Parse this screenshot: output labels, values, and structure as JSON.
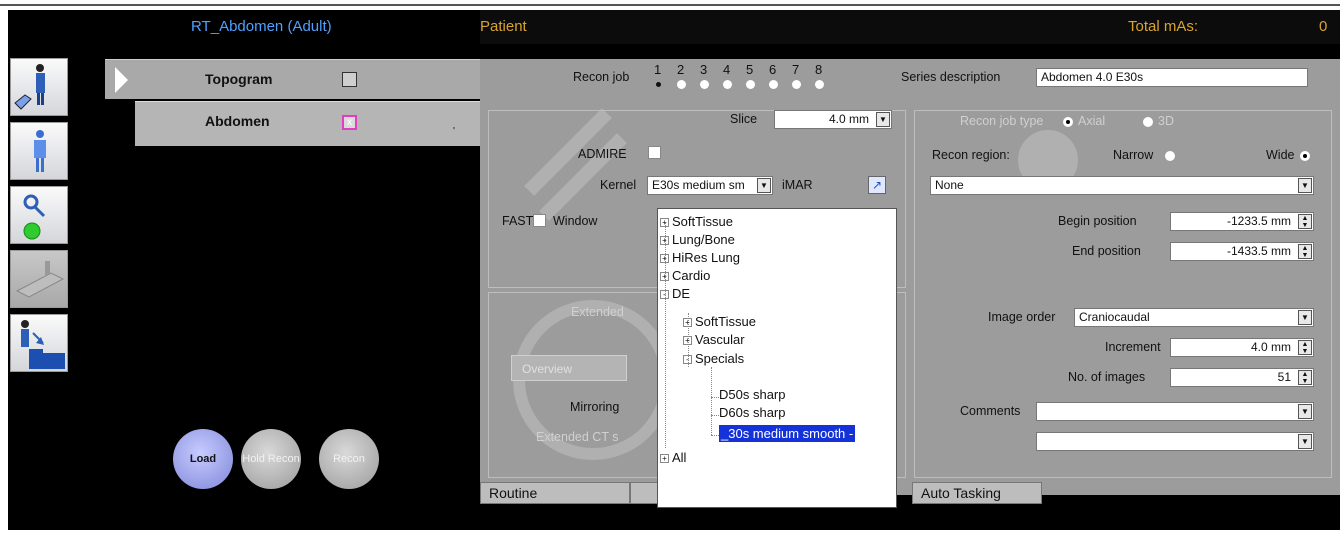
{
  "header": {
    "protocol": "RT_Abdomen (Adult)",
    "patient": "Patient",
    "total_mas_label": "Total mAs:",
    "total_mas_value": "0"
  },
  "protocol_list": {
    "topogram": "Topogram",
    "abdomen": "Abdomen",
    "abdomen_check": "x",
    "row_marker": "'"
  },
  "buttons": {
    "load": "Load",
    "hold_recon": "Hold Recon",
    "recon": "Recon"
  },
  "recon_job": {
    "label": "Recon job",
    "numbers": [
      "1",
      "2",
      "3",
      "4",
      "5",
      "6",
      "7",
      "8"
    ],
    "selected": 1
  },
  "series": {
    "label": "Series description",
    "value": "Abdomen 4.0 E30s"
  },
  "slice": {
    "label": "Slice",
    "value": "4.0 mm"
  },
  "admire": {
    "label": "ADMIRE"
  },
  "kernel": {
    "label": "Kernel",
    "value": "E30s medium sm",
    "imar_label": "iMAR"
  },
  "fast": {
    "fast_label": "FAST",
    "window_label": "Window"
  },
  "extended": {
    "label": "Extended",
    "ct_label": "Extended CT s"
  },
  "overview": {
    "label": "Overview",
    "mirroring_label": "Mirroring"
  },
  "kernel_tree": {
    "items": [
      {
        "label": "SoftTissue",
        "sign": "+"
      },
      {
        "label": "Lung/Bone",
        "sign": "+"
      },
      {
        "label": "HiRes Lung",
        "sign": "+"
      },
      {
        "label": "Cardio",
        "sign": "+"
      },
      {
        "label": "DE",
        "sign": "-"
      },
      {
        "label": "SoftTissue",
        "sign": "+"
      },
      {
        "label": "Vascular",
        "sign": "+"
      },
      {
        "label": "Specials",
        "sign": "-"
      },
      {
        "label": "D50s sharp",
        "sign": ""
      },
      {
        "label": "D60s sharp",
        "sign": ""
      },
      {
        "label": "_30s medium smooth -",
        "sign": ""
      },
      {
        "label": "All",
        "sign": "+"
      }
    ]
  },
  "recon_type": {
    "label": "Recon job type",
    "axial": "Axial",
    "three_d": "3D"
  },
  "recon_region": {
    "label": "Recon region:",
    "narrow": "Narrow",
    "wide": "Wide",
    "value": "None"
  },
  "positions": {
    "begin_label": "Begin position",
    "begin_value": "-1233.5 mm",
    "end_label": "End position",
    "end_value": "-1433.5 mm"
  },
  "image_order": {
    "label": "Image order",
    "value": "Craniocaudal"
  },
  "increment": {
    "label": "Increment",
    "value": "4.0 mm"
  },
  "num_images": {
    "label": "No. of images",
    "value": "51"
  },
  "comments": {
    "label": "Comments",
    "value1": "",
    "value2": ""
  },
  "tabs": {
    "routine": "Routine",
    "auto_tasking": "Auto Tasking"
  },
  "colors": {
    "header_text": "#d8a430",
    "protocol_text": "#4fa0ff",
    "panel": "#9c9c9c",
    "selection": "#1432d8",
    "load_button": "#8f96e6"
  }
}
